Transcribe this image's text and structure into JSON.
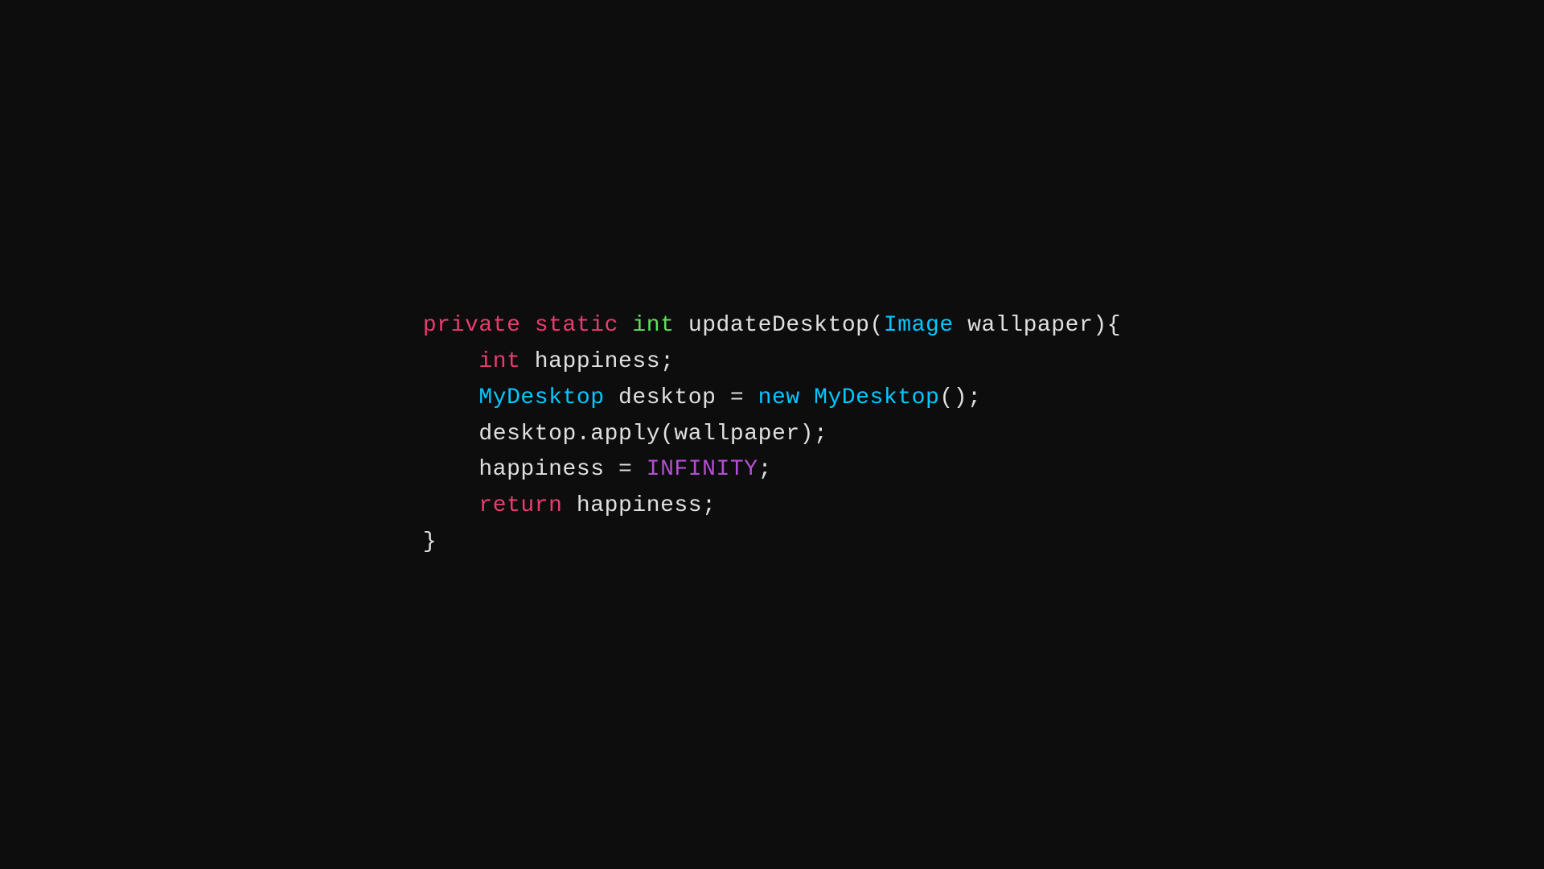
{
  "code": {
    "line1": {
      "keyword_private": "private",
      "space1": " ",
      "keyword_static": "static",
      "space2": " ",
      "keyword_int": "int",
      "space3": " ",
      "method_name": "updateDesktop(",
      "class_image": "Image",
      "param": " wallpaper){"
    },
    "line2": {
      "indent": "    ",
      "keyword_int": "int",
      "rest": " happiness;"
    },
    "line3": {
      "indent": "    ",
      "class_mydesktop": "MyDesktop",
      "rest": " desktop = ",
      "keyword_new": "new",
      "space": " ",
      "class_mydesktop2": "MyDesktop",
      "end": "();"
    },
    "line4": {
      "indent": "    ",
      "rest": "desktop.apply(wallpaper);"
    },
    "line5": {
      "indent": "    ",
      "rest": "happiness = ",
      "const_infinity": "INFINITY",
      "end": ";"
    },
    "line6": {
      "indent": "    ",
      "keyword_return": "return",
      "rest": " happiness;"
    },
    "line7": {
      "brace": "}"
    }
  }
}
